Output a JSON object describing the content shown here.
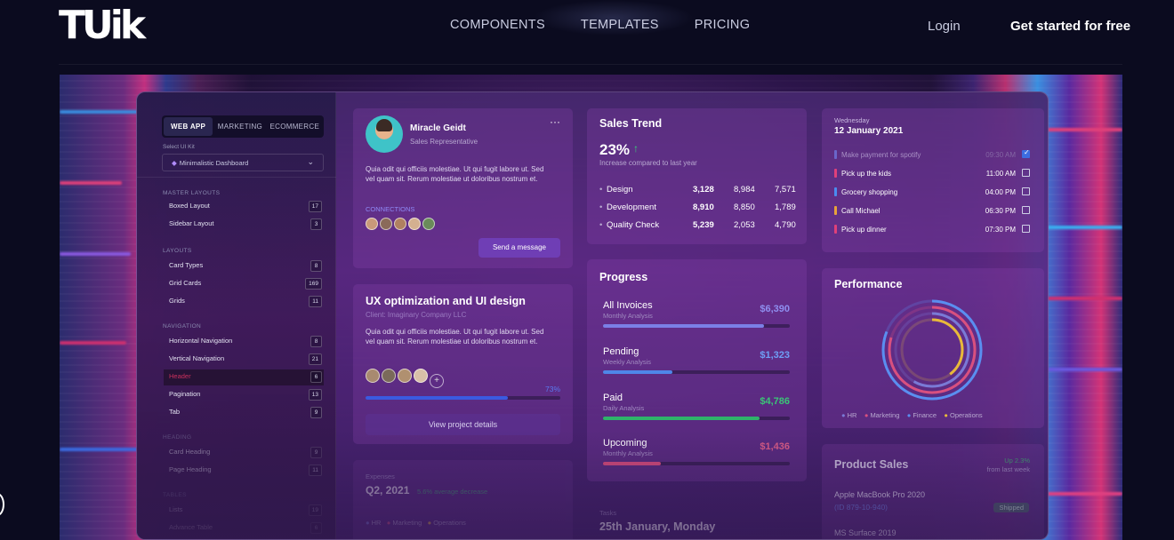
{
  "nav": {
    "logo": "TUik",
    "links": [
      "COMPONENTS",
      "TEMPLATES",
      "PRICING"
    ],
    "login": "Login",
    "cta": "Get started for free"
  },
  "sidebar": {
    "tabs": [
      "WEB APP",
      "MARKETING",
      "ECOMMERCE"
    ],
    "select_label": "Select UI Kit",
    "select_value": "Minimalistic Dashboard",
    "sections": [
      {
        "title": "MASTER LAYOUTS",
        "items": [
          {
            "label": "Boxed Layout",
            "count": "17"
          },
          {
            "label": "Sidebar Layout",
            "count": "3"
          }
        ]
      },
      {
        "title": "LAYOUTS",
        "items": [
          {
            "label": "Card Types",
            "count": "8"
          },
          {
            "label": "Grid Cards",
            "count": "169"
          },
          {
            "label": "Grids",
            "count": "11"
          }
        ]
      },
      {
        "title": "NAVIGATION",
        "items": [
          {
            "label": "Horizontal Navigation",
            "count": "8"
          },
          {
            "label": "Vertical Navigation",
            "count": "21"
          },
          {
            "label": "Header",
            "count": "6"
          },
          {
            "label": "Pagination",
            "count": "13"
          },
          {
            "label": "Tab",
            "count": "9"
          }
        ]
      },
      {
        "title": "HEADING",
        "items": [
          {
            "label": "Card Heading",
            "count": "9"
          },
          {
            "label": "Page Heading",
            "count": "11"
          }
        ]
      },
      {
        "title": "TABLES",
        "items": [
          {
            "label": "Lists",
            "count": "19"
          },
          {
            "label": "Advance Table",
            "count": "6"
          }
        ]
      }
    ]
  },
  "profile": {
    "name": "Miracle Geidt",
    "role": "Sales Representative",
    "bio": "Quia odit qui officiis molestiae. Ut qui fugit labore ut. Sed vel quam sit. Rerum molestiae ut doloribus nostrum et.",
    "connections_label": "CONNECTIONS",
    "message_button": "Send a message"
  },
  "project": {
    "title": "UX optimization and UI design",
    "client": "Client: Imaginary Company LLC",
    "desc": "Quia odit qui officiis molestiae. Ut qui fugit labore ut. Sed vel quam sit. Rerum molestiae ut doloribus nostrum et.",
    "progress_label": "73%",
    "progress": 0.73,
    "button": "View project details"
  },
  "expenses": {
    "label": "Expenses",
    "period": "Q2, 2021",
    "note": "5.6% average decrease",
    "legend": [
      "HR",
      "Marketing",
      "Operations"
    ]
  },
  "sales_trend": {
    "title": "Sales Trend",
    "value": "23%",
    "arrow": "↑",
    "caption": "Increase compared to last year",
    "rows": [
      {
        "name": "Design",
        "a": "3,128",
        "b": "8,984",
        "c": "7,571"
      },
      {
        "name": "Development",
        "a": "8,910",
        "b": "8,850",
        "c": "1,789"
      },
      {
        "name": "Quality Check",
        "a": "5,239",
        "b": "2,053",
        "c": "4,790"
      }
    ]
  },
  "progress": {
    "title": "Progress",
    "items": [
      {
        "name": "All Invoices",
        "sub": "Monthly Analysis",
        "amount": "$6,390",
        "fill": 0.86,
        "color": "#7b7fe6",
        "amount_color": "#8f8ff0"
      },
      {
        "name": "Pending",
        "sub": "Weekly Analysis",
        "amount": "$1,323",
        "fill": 0.37,
        "color": "#4f86e8",
        "amount_color": "#6e9ff5"
      },
      {
        "name": "Paid",
        "sub": "Daily Analysis",
        "amount": "$4,786",
        "fill": 0.84,
        "color": "#2fb36a",
        "amount_color": "#3bc577"
      },
      {
        "name": "Upcoming",
        "sub": "Monthly Analysis",
        "amount": "$1,436",
        "fill": 0.31,
        "color": "#d24a7a",
        "amount_color": "#d85c86"
      }
    ]
  },
  "tasks": {
    "label": "Tasks",
    "date": "25th January, Monday"
  },
  "todo": {
    "weekday": "Wednesday",
    "date": "12 January 2021",
    "items": [
      {
        "text": "Make payment for spotify",
        "time": "09:30 AM",
        "done": true,
        "color": "#6a66c9"
      },
      {
        "text": "Pick up the kids",
        "time": "11:00 AM",
        "done": false,
        "color": "#e0407a"
      },
      {
        "text": "Grocery shopping",
        "time": "04:00 PM",
        "done": false,
        "color": "#4a8cf0"
      },
      {
        "text": "Call Michael",
        "time": "06:30 PM",
        "done": false,
        "color": "#e8a23a"
      },
      {
        "text": "Pick up dinner",
        "time": "07:30 PM",
        "done": false,
        "color": "#e0407a"
      }
    ]
  },
  "performance": {
    "title": "Performance",
    "legend": [
      {
        "name": "HR",
        "color": "#7a7ad6"
      },
      {
        "name": "Marketing",
        "color": "#d8507f"
      },
      {
        "name": "Finance",
        "color": "#5a8ef0"
      },
      {
        "name": "Operations",
        "color": "#e8b93a"
      }
    ]
  },
  "product_sales": {
    "title": "Product Sales",
    "change": "Up 2.3%",
    "change_note": "from last week",
    "items": [
      {
        "name": "Apple MacBook Pro 2020",
        "id": "(ID 879-10-940)",
        "status": "Shipped"
      },
      {
        "name": "MS Surface 2019",
        "id": "",
        "status": ""
      }
    ]
  }
}
